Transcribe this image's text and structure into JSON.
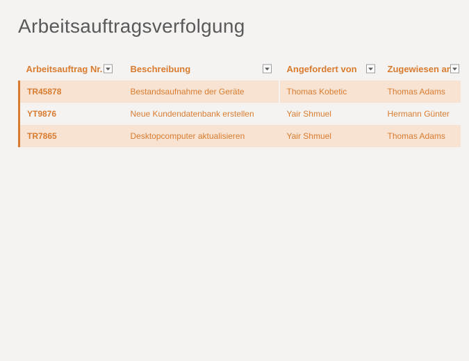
{
  "title": "Arbeitsauftragsverfolgung",
  "columns": {
    "work_order": "Arbeitsauftrag Nr.",
    "description": "Beschreibung",
    "requested_by": "Angefordert von",
    "assigned_to": "Zugewiesen an"
  },
  "rows": [
    {
      "work_order": "TR45878",
      "description": "Bestandsaufnahme der Geräte",
      "requested_by": "Thomas Kobetic",
      "assigned_to": "Thomas Adams"
    },
    {
      "work_order": "YT9876",
      "description": "Neue Kundendatenbank erstellen",
      "requested_by": "Yair Shmuel",
      "assigned_to": "Hermann Günter"
    },
    {
      "work_order": "TR7865",
      "description": "Desktopcomputer aktualisieren",
      "requested_by": "Yair Shmuel",
      "assigned_to": "Thomas Adams"
    }
  ]
}
